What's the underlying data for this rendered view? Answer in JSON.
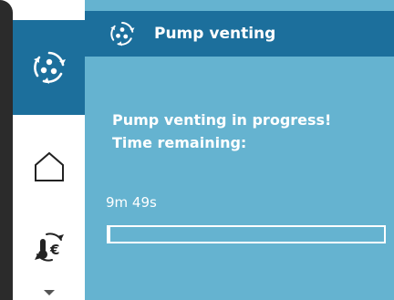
{
  "header": {
    "title": "Pump venting",
    "icon": "pump-venting-icon"
  },
  "sidebar": {
    "items": [
      {
        "icon": "pump-venting-icon",
        "active": true
      },
      {
        "icon": "home-icon",
        "active": false
      },
      {
        "icon": "thermometer-euro-icon",
        "active": false
      }
    ],
    "scroll": "chevron-down-icon"
  },
  "main": {
    "message_line1": "Pump venting in progress!",
    "message_line2": "Time remaining:",
    "time_remaining": "9m 49s",
    "progress_fraction": 0.005
  },
  "colors": {
    "accent": "#1c6f9c",
    "panel": "#65b3d0",
    "text": "#ffffff"
  }
}
